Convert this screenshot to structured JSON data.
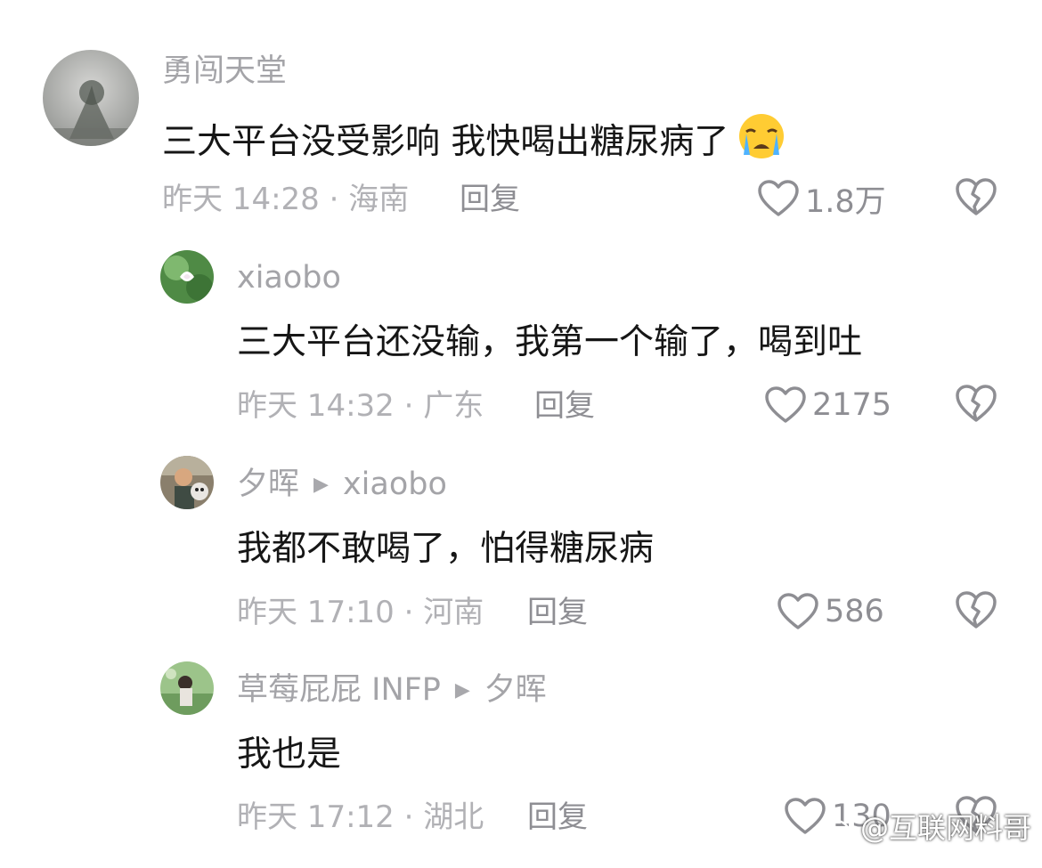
{
  "comments": [
    {
      "username": "勇闯天堂",
      "reply_to": "",
      "text": "三大平台没受影响 我快喝出糖尿病了",
      "emoji": "crying-face",
      "time": "昨天 14:28",
      "location": "海南",
      "reply_label": "回复",
      "likes": "1.8万"
    },
    {
      "username": "xiaobo",
      "reply_to": "",
      "text": "三大平台还没输，我第一个输了，喝到吐",
      "time": "昨天 14:32",
      "location": "广东",
      "reply_label": "回复",
      "likes": "2175"
    },
    {
      "username": "夕晖",
      "reply_to": "xiaobo",
      "text": "我都不敢喝了，怕得糖尿病",
      "time": "昨天 17:10",
      "location": "河南",
      "reply_label": "回复",
      "likes": "586"
    },
    {
      "username": "草莓屁屁 INFP",
      "reply_to": "夕晖",
      "text": "我也是",
      "time": "昨天 17:12",
      "location": "湖北",
      "reply_label": "回复",
      "likes": "130"
    }
  ],
  "watermark": "@互联网料哥",
  "colors": {
    "username": "#a4a4a8",
    "text": "#161616",
    "meta": "#b1b1b5",
    "action": "#8e8e93"
  }
}
